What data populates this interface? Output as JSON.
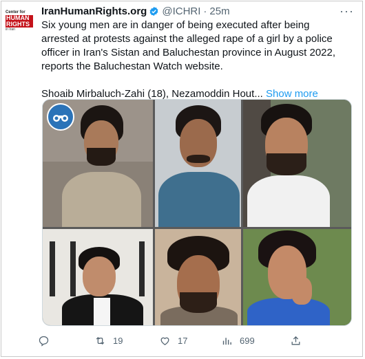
{
  "account": {
    "avatar_line1": "Center for",
    "avatar_line2": "HUMAN RIGHTS",
    "avatar_line3": "in Iran",
    "display_name": "IranHumanRights.org",
    "handle": "@ICHRI",
    "separator": "·",
    "time": "25m"
  },
  "more_menu": "···",
  "tweet": {
    "paragraph1": "Six young men are in danger of being executed after being arrested at protests against the alleged rape of a girl by a police officer in Iran's Sistan and Baluchestan province in August 2022, reports the Baluchestan Watch website.",
    "paragraph2": "Shoaib Mirbaluch-Zahi (18), Nezamoddin Hout...",
    "show_more": "Show more"
  },
  "media": {
    "photos": [
      "man-in-grey-shirt",
      "man-in-blue-shirt",
      "man-in-white-shirt",
      "man-in-black-jacket",
      "man-with-beard",
      "man-in-blue-with-hand-on-chin"
    ],
    "badge_icon": "binoculars-icon"
  },
  "actions": {
    "reply": {
      "icon": "reply-icon",
      "count": ""
    },
    "retweet": {
      "icon": "retweet-icon",
      "count": "19"
    },
    "like": {
      "icon": "heart-icon",
      "count": "17"
    },
    "views": {
      "icon": "views-icon",
      "count": "699"
    },
    "share": {
      "icon": "share-icon",
      "count": ""
    }
  },
  "colors": {
    "accent": "#1d9bf0",
    "text": "#0f1419",
    "muted": "#536471",
    "brand_red": "#c4121a"
  }
}
